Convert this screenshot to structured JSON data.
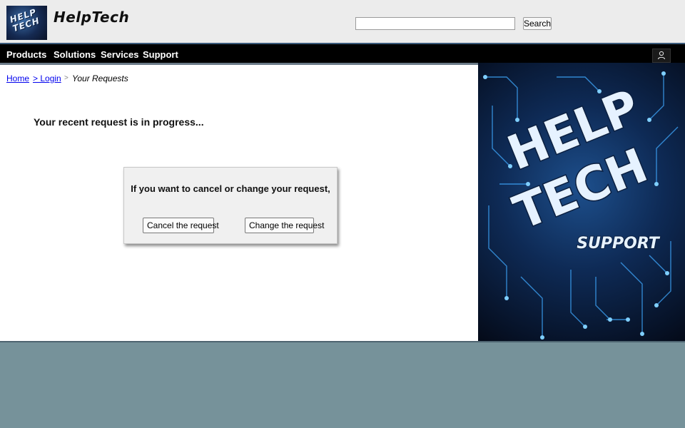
{
  "header": {
    "logo_text": "HELP TECH",
    "brand": "HelpTech",
    "search": {
      "value": "",
      "button_label": "Search"
    }
  },
  "nav": {
    "items": [
      "Products",
      "Solutions",
      "Services",
      "Support"
    ],
    "user_icon": "user-icon"
  },
  "breadcrumb": {
    "home": "Home",
    "login": "> Login",
    "separator": ">",
    "current": "Your Requests"
  },
  "main": {
    "status_text": "Your recent request is in progress...",
    "panel": {
      "message": "If you want to cancel or change your request,",
      "cancel_label": "Cancel the request",
      "change_label": "Change the request"
    }
  },
  "hero": {
    "line1": "HELP",
    "line2": "TECH",
    "line3": "SUPPORT"
  },
  "colors": {
    "page_bg": "#76929a",
    "nav_bg": "#000000",
    "link": "#0000ee",
    "hero_glow": "#3fa9ff"
  }
}
